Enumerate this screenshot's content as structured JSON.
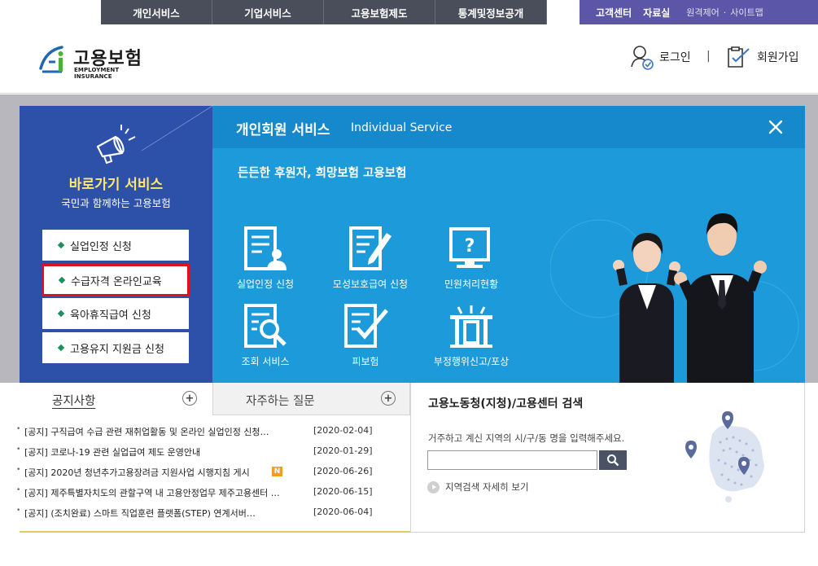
{
  "top_nav": {
    "items": [
      "개인서비스",
      "기업서비스",
      "고용보험제도",
      "통계및정보공개"
    ],
    "util": {
      "customer_center": "고객센터",
      "resources": "자료실",
      "remote_control": "원격제어",
      "dot": "·",
      "sitemap": "사이트맵"
    }
  },
  "header": {
    "logo_ko": "고용보험",
    "logo_en": "EMPLOYMENT INSURANCE",
    "login": "로그인",
    "separator": "|",
    "join": "회원가입"
  },
  "quick": {
    "title": "바로가기 서비스",
    "subtitle": "국민과 함께하는 고용보험",
    "items": [
      {
        "label": "실업인정 신청",
        "highlighted": false
      },
      {
        "label": "수급자격 온라인교육",
        "highlighted": true
      },
      {
        "label": "육아휴직급여 신청",
        "highlighted": false
      },
      {
        "label": "고용유지 지원금 신청",
        "highlighted": false
      }
    ],
    "highlight_color": "#e1101c"
  },
  "service": {
    "title": "개인회원 서비스",
    "title_en": "Individual Service",
    "slogan": "든든한 후원자, 희망보험 고용보험",
    "items": [
      {
        "label": "실업인정 신청",
        "icon": "document-person-icon"
      },
      {
        "label": "모성보호급여 신청",
        "icon": "document-pen-icon"
      },
      {
        "label": "민원처리현황",
        "icon": "monitor-question-icon"
      },
      {
        "label": "조회 서비스",
        "icon": "document-search-icon"
      },
      {
        "label": "피보험",
        "icon": "document-check-icon"
      },
      {
        "label": "부정행위신고/포상",
        "icon": "report-award-icon"
      }
    ]
  },
  "notice": {
    "tab_notice": "공지사항",
    "tab_faq": "자주하는 질문",
    "plus": "+",
    "bullet": "•",
    "rows": [
      {
        "text": "[공지] 구직급여 수급 관련 재취업활동 및 온라인 실업인정 신청…",
        "date": "[2020-02-04]",
        "new": false
      },
      {
        "text": "[공지] 코로나-19 관련 실업급여 제도 운영안내",
        "date": "[2020-01-29]",
        "new": false
      },
      {
        "text": "[공지] 2020년 청년추가고용장려금 지원사업 시행지침 게시",
        "date": "[2020-06-26]",
        "new": true
      },
      {
        "text": "[공지] 제주특별자치도의 관할구역 내 고용안정업무 제주고용센터 …",
        "date": "[2020-06-15]",
        "new": false
      },
      {
        "text": "[공지] (조치완료) 스마트 직업훈련 플랫폼(STEP) 연계서버…",
        "date": "[2020-06-04]",
        "new": false
      }
    ],
    "new_badge": "N"
  },
  "center": {
    "title": "고용노동청(지청)/고용센터 검색",
    "description": "거주하고 계신 지역의 시/구/동 명을 입력해주세요.",
    "input_value": "",
    "more": "지역검색 자세히 보기"
  },
  "colors": {
    "nav_bg": "#4a4d5a",
    "util_bg": "#5b56a8",
    "quick_bg": "#2d51a8",
    "service_bg": "#1c9ad9",
    "quick_title": "#ffe86a"
  }
}
